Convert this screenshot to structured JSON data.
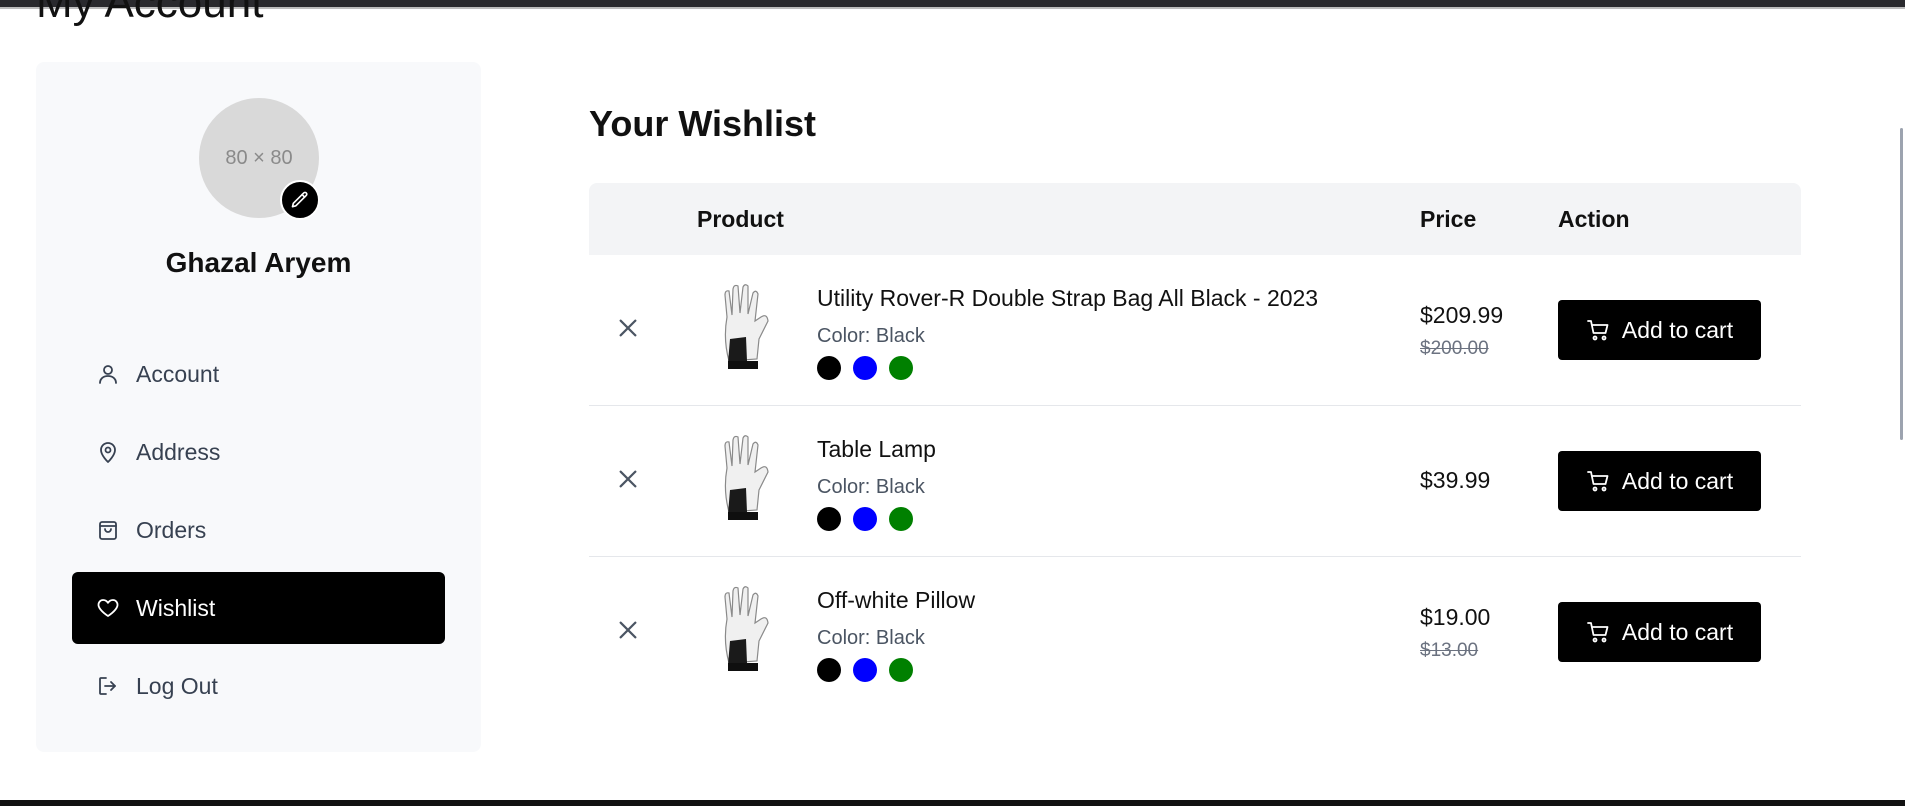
{
  "page": {
    "title": "My Account"
  },
  "profile": {
    "avatar_placeholder": "80 × 80",
    "name": "Ghazal Aryem"
  },
  "sidebar": {
    "items": [
      {
        "label": "Account",
        "icon": "user-icon",
        "active": false
      },
      {
        "label": "Address",
        "icon": "map-pin-icon",
        "active": false
      },
      {
        "label": "Orders",
        "icon": "shopping-bag-icon",
        "active": false
      },
      {
        "label": "Wishlist",
        "icon": "heart-icon",
        "active": true
      },
      {
        "label": "Log Out",
        "icon": "logout-icon",
        "active": false
      }
    ]
  },
  "wishlist": {
    "title": "Your Wishlist",
    "columns": {
      "product": "Product",
      "price": "Price",
      "action": "Action"
    },
    "items": [
      {
        "name": "Utility Rover-R Double Strap Bag All Black - 2023",
        "color": "Color: Black",
        "price": "$209.99",
        "old_price": "$200.00",
        "action": "Add to cart"
      },
      {
        "name": "Table Lamp",
        "color": "Color: Black",
        "price": "$39.99",
        "old_price": "",
        "action": "Add to cart"
      },
      {
        "name": "Off-white Pillow",
        "color": "Color: Black",
        "price": "$19.00",
        "old_price": "$13.00",
        "action": "Add to cart"
      }
    ],
    "swatch_colors": [
      "#000000",
      "#0000ff",
      "#008000"
    ]
  },
  "colors": {
    "accent": "#000000",
    "sidebar_bg": "#f8f9fb",
    "table_header_bg": "#f3f4f6"
  }
}
